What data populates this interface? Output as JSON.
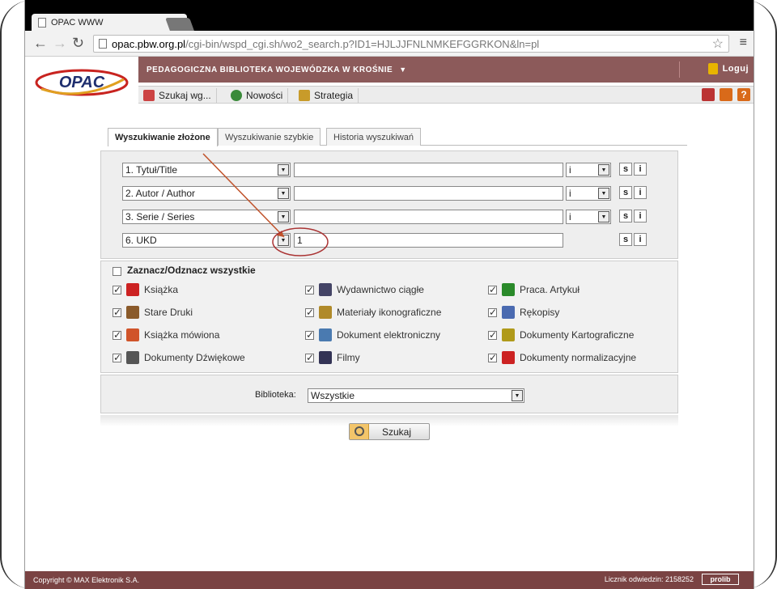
{
  "browser": {
    "tab_title": "OPAC WWW",
    "url_host": "opac.pbw.org.pl",
    "url_path": "/cgi-bin/wspd_cgi.sh/wo2_search.p?ID1=HJLJJFNLNMKEFGGRKON&ln=pl"
  },
  "header": {
    "logo_text": "OPAC",
    "library_name": "PEDAGOGICZNA BIBLIOTEKA WOJEWÓDZKA W KROŚNIE",
    "login_label": "Loguj",
    "nav": [
      {
        "label": "Szukaj wg...",
        "color": "#c44"
      },
      {
        "label": "Nowości",
        "color": "#3a8a3a"
      },
      {
        "label": "Strategia",
        "color": "#c89b2a"
      }
    ]
  },
  "search_tabs": [
    {
      "label": "Wyszukiwanie złożone",
      "active": true
    },
    {
      "label": "Wyszukiwanie szybkie",
      "active": false
    },
    {
      "label": "Historia wyszukiwań",
      "active": false
    }
  ],
  "criteria": [
    {
      "index_label": "1. Tytuł/Title",
      "value": "",
      "operator": "i",
      "s": "s",
      "i": "i"
    },
    {
      "index_label": "2. Autor / Author",
      "value": "",
      "operator": "i",
      "s": "s",
      "i": "i"
    },
    {
      "index_label": "3. Serie / Series",
      "value": "",
      "operator": "i",
      "s": "s",
      "i": "i"
    },
    {
      "index_label": "6. UKD",
      "value": "1",
      "operator": "",
      "s": "s",
      "i": "i"
    }
  ],
  "doc_types": {
    "toggle_all_label": "Zaznacz/Odznacz wszystkie",
    "items": [
      {
        "label": "Książka",
        "checked": true,
        "icon": "book-icon",
        "color": "#c22"
      },
      {
        "label": "Wydawnictwo ciągłe",
        "checked": true,
        "icon": "periodical-icon",
        "color": "#446"
      },
      {
        "label": "Praca. Artykuł",
        "checked": true,
        "icon": "article-icon",
        "color": "#2a8a2a"
      },
      {
        "label": "Stare Druki",
        "checked": true,
        "icon": "old-prints-icon",
        "color": "#8a5a2a"
      },
      {
        "label": "Materiały ikonograficzne",
        "checked": true,
        "icon": "iconography-icon",
        "color": "#b08a2a"
      },
      {
        "label": "Rękopisy",
        "checked": true,
        "icon": "manuscript-icon",
        "color": "#4a6ab0"
      },
      {
        "label": "Książka mówiona",
        "checked": true,
        "icon": "audiobook-icon",
        "color": "#d0542a"
      },
      {
        "label": "Dokument elektroniczny",
        "checked": true,
        "icon": "cd-icon",
        "color": "#4a7ab0"
      },
      {
        "label": "Dokumenty Kartograficzne",
        "checked": true,
        "icon": "map-icon",
        "color": "#b09a1a"
      },
      {
        "label": "Dokumenty Dźwiękowe",
        "checked": true,
        "icon": "speaker-icon",
        "color": "#555"
      },
      {
        "label": "Filmy",
        "checked": true,
        "icon": "film-icon",
        "color": "#335"
      },
      {
        "label": "Dokumenty normalizacyjne",
        "checked": true,
        "icon": "norm-doc-icon",
        "color": "#c22"
      }
    ]
  },
  "library": {
    "label": "Biblioteka:",
    "value": "Wszystkie"
  },
  "search_button": "Szukaj",
  "footer": {
    "copyright": "Copyright © MAX Elektronik S.A.",
    "counter": "Licznik odwiedzin: 2158252",
    "brand": "prolib"
  }
}
